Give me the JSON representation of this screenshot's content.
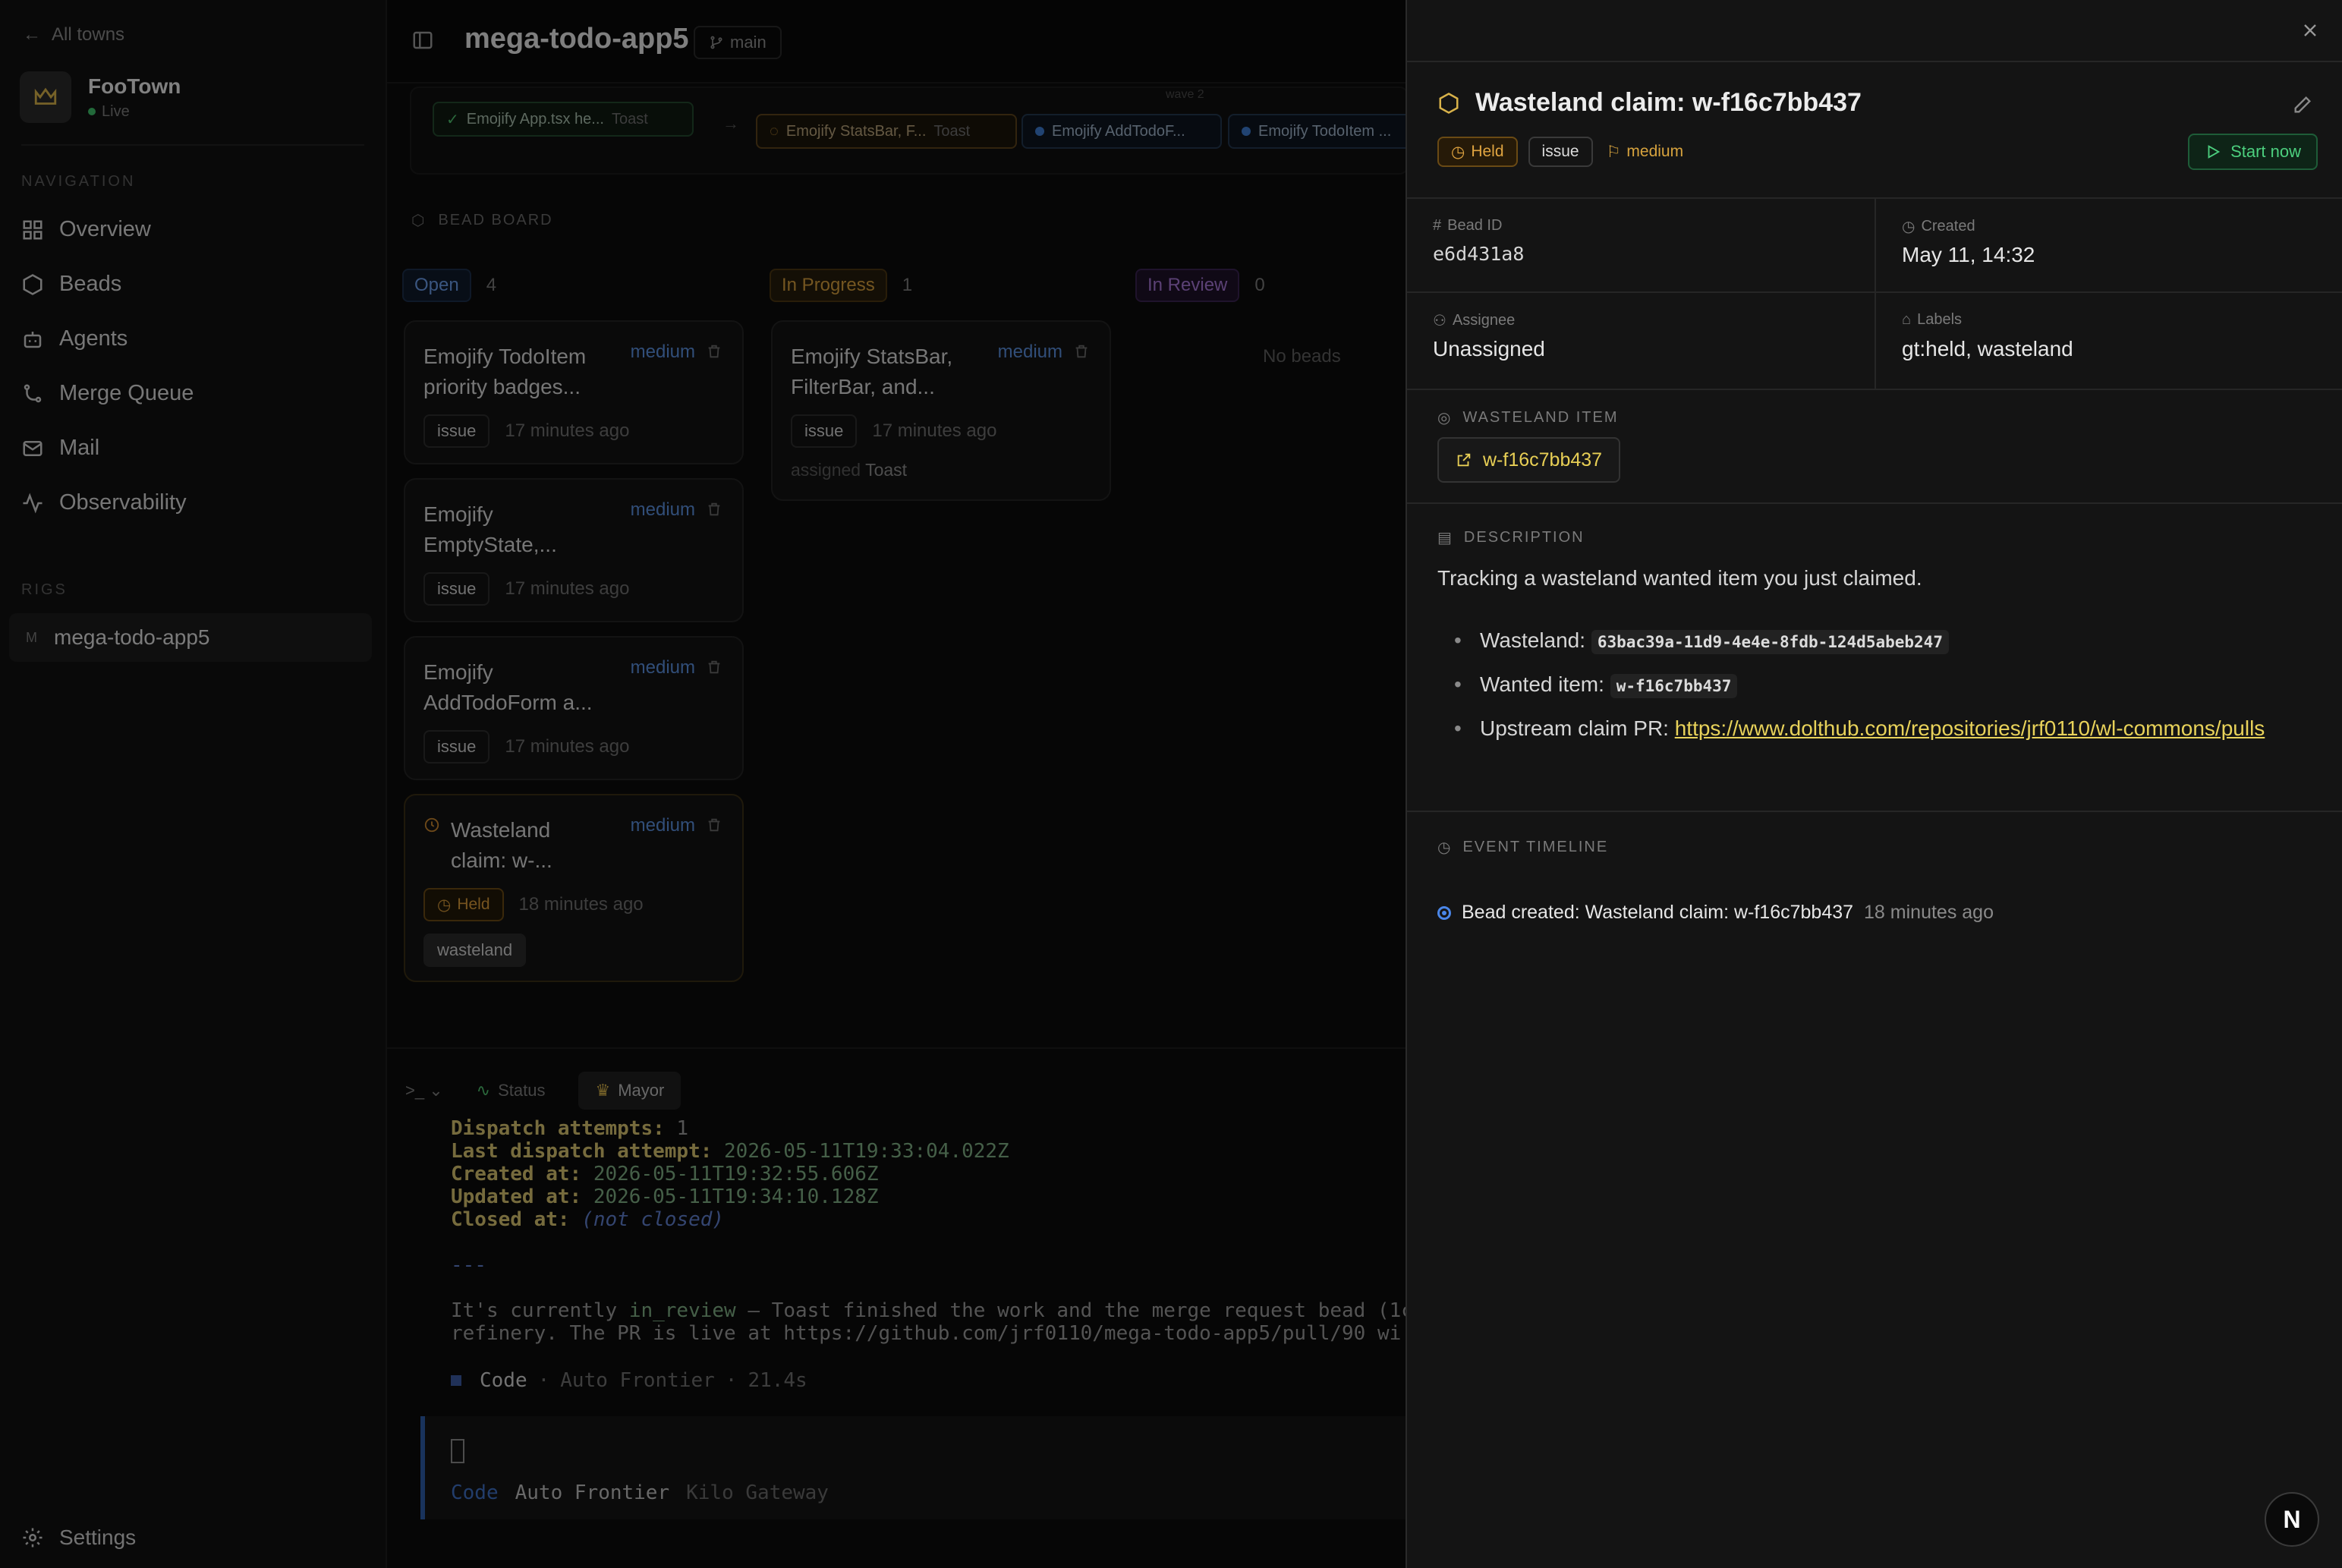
{
  "sidebar": {
    "back_label": "All towns",
    "town_name": "FooTown",
    "town_status": "Live",
    "nav_title": "NAVIGATION",
    "nav_items": [
      "Overview",
      "Beads",
      "Agents",
      "Merge Queue",
      "Mail",
      "Observability"
    ],
    "rigs_title": "RIGS",
    "rig_letter": "M",
    "rig_name": "mega-todo-app5",
    "settings_label": "Settings"
  },
  "header": {
    "project_title": "mega-todo-app5",
    "branch": "main"
  },
  "convoy": {
    "wave_label": "wave 2",
    "chips": [
      {
        "label": "Emojify App.tsx he...",
        "agent": "Toast"
      },
      {
        "label": "Emojify StatsBar, F...",
        "agent": "Toast"
      },
      {
        "label": "Emojify AddTodoF..."
      },
      {
        "label": "Emojify TodoItem ..."
      }
    ]
  },
  "board": {
    "title": "BEAD BOARD",
    "columns": [
      {
        "label": "Open",
        "count": "4"
      },
      {
        "label": "In Progress",
        "count": "1"
      },
      {
        "label": "In Review",
        "count": "0"
      }
    ],
    "open_cards": [
      {
        "title": "Emojify TodoItem priority badges...",
        "priority": "medium",
        "tag": "issue",
        "time": "17 minutes ago"
      },
      {
        "title": "Emojify EmptyState,...",
        "priority": "medium",
        "tag": "issue",
        "time": "17 minutes ago"
      },
      {
        "title": "Emojify AddTodoForm a...",
        "priority": "medium",
        "tag": "issue",
        "time": "17 minutes ago"
      },
      {
        "title": "Wasteland claim: w-...",
        "priority": "medium",
        "tag": "Held",
        "time": "18 minutes ago",
        "label": "wasteland"
      }
    ],
    "progress_cards": [
      {
        "title": "Emojify StatsBar, FilterBar, and...",
        "priority": "medium",
        "tag": "issue",
        "time": "17 minutes ago",
        "assigned_prefix": "assigned",
        "assignee": "Toast"
      }
    ],
    "empty_label": "No beads"
  },
  "terminal": {
    "tabs": [
      "Status",
      "Mayor"
    ],
    "lines": {
      "dispatch_attempts_key": "Dispatch attempts:",
      "dispatch_attempts_val": "1",
      "last_dispatch_key": "Last dispatch attempt:",
      "last_dispatch_val": "2026-05-11T19:33:04.022Z",
      "created_key": "Created at:",
      "created_val": "2026-05-11T19:32:55.606Z",
      "updated_key": "Updated at:",
      "updated_val": "2026-05-11T19:34:10.128Z",
      "closed_key": "Closed at:",
      "closed_val": "(not closed)",
      "hr": "---",
      "para1_a": "It's currently ",
      "para1_code": "in_review",
      "para1_b": " — Toast finished the work and the merge request bead (1c",
      "para2": "refinery. The PR is live at https://github.com/jrf0110/mega-todo-app5/pull/90 wi"
    },
    "code_label": "Code",
    "code_model": "Auto Frontier",
    "code_time": "21.4s",
    "input_mode": "Code",
    "input_model": "Auto Frontier",
    "input_provider": "Kilo Gateway"
  },
  "detail": {
    "title": "Wasteland claim: w-f16c7bb437",
    "tag_held": "Held",
    "tag_issue": "issue",
    "tag_priority": "medium",
    "start_button": "Start now",
    "bead_id_label": "Bead ID",
    "bead_id": "e6d431a8",
    "created_label": "Created",
    "created": "May 11, 14:32",
    "assignee_label": "Assignee",
    "assignee": "Unassigned",
    "labels_label": "Labels",
    "labels": "gt:held, wasteland",
    "wasteland_item_title": "WASTELAND ITEM",
    "wasteland_item": "w-f16c7bb437",
    "description_title": "DESCRIPTION",
    "description": "Tracking a wasteland wanted item you just claimed.",
    "bullets": {
      "wasteland_label": "Wasteland: ",
      "wasteland_value": "63bac39a-11d9-4e4e-8fdb-124d5abeb247",
      "wanted_label": "Wanted item: ",
      "wanted_value": "w-f16c7bb437",
      "upstream_label": "Upstream claim PR: ",
      "upstream_url": "https://www.dolthub.com/repositories/jrf0110/wl-commons/pulls"
    },
    "timeline_title": "EVENT TIMELINE",
    "timeline_event": "Bead created: Wasteland claim: w-f16c7bb437",
    "timeline_time": "18 minutes ago"
  },
  "badge_letter": "N"
}
